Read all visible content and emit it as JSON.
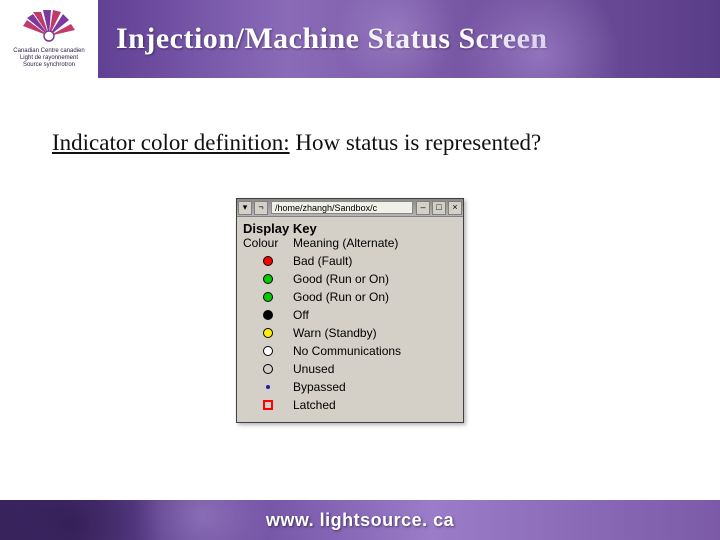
{
  "header": {
    "title": "Injection/Machine Status Screen",
    "logo_text": "Canadian  Centre canadien\nLight de rayonnement\nSource  synchrotron"
  },
  "subtitle": {
    "underlined": "Indicator color definition:",
    "rest": " How status is represented?"
  },
  "window": {
    "path": "/home/zhangh/Sandbox/c",
    "heading": "Display Key",
    "col_label_1": "Colour",
    "col_label_2": "Meaning (Alternate)",
    "rows": [
      {
        "color": "#ff0000",
        "style": "dot",
        "label": "Bad (Fault)"
      },
      {
        "color": "#00cc00",
        "style": "dot",
        "label": "Good (Run or On)"
      },
      {
        "color": "#00cc00",
        "style": "dot",
        "label": "Good (Run or On)"
      },
      {
        "color": "#000000",
        "style": "dot",
        "label": "Off"
      },
      {
        "color": "#ffee00",
        "style": "dot",
        "label": "Warn (Standby)"
      },
      {
        "color": "#ffffff",
        "style": "dot",
        "label": "No Communications"
      },
      {
        "color": "",
        "style": "circle-open",
        "label": "Unused"
      },
      {
        "color": "#2020aa",
        "style": "tiny-dot",
        "label": "Bypassed"
      },
      {
        "color": "#ff0000",
        "style": "square-open",
        "label": "Latched"
      }
    ]
  },
  "footer": {
    "url": "www. lightsource. ca"
  }
}
